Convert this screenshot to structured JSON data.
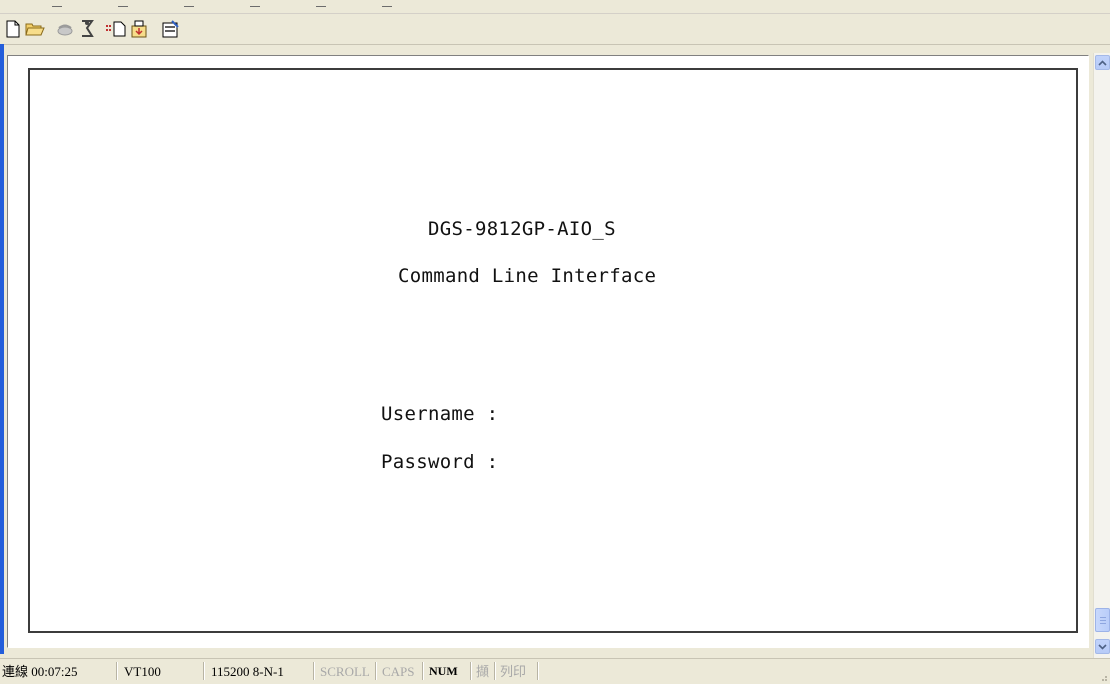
{
  "toolbar": {
    "icons": [
      "new-icon",
      "open-icon",
      "disconnect-icon",
      "connect-icon",
      "send-icon",
      "receive-icon",
      "properties-icon"
    ]
  },
  "terminal": {
    "device_name": "DGS-9812GP-AIO_S",
    "subtitle": "Command Line Interface",
    "username_label": "Username :",
    "password_label": "Password :"
  },
  "statusbar": {
    "connection": "連線 00:07:25",
    "emulation": "VT100",
    "port_settings": "115200 8-N-1",
    "scroll": "SCROLL",
    "caps": "CAPS",
    "num": "NUM",
    "capture": "擷",
    "print": "列印"
  },
  "colors": {
    "window_bg": "#ece9d8",
    "terminal_bg": "#ffffff",
    "window_edge": "#245edb",
    "scroll_accent": "#b7cbf8"
  }
}
